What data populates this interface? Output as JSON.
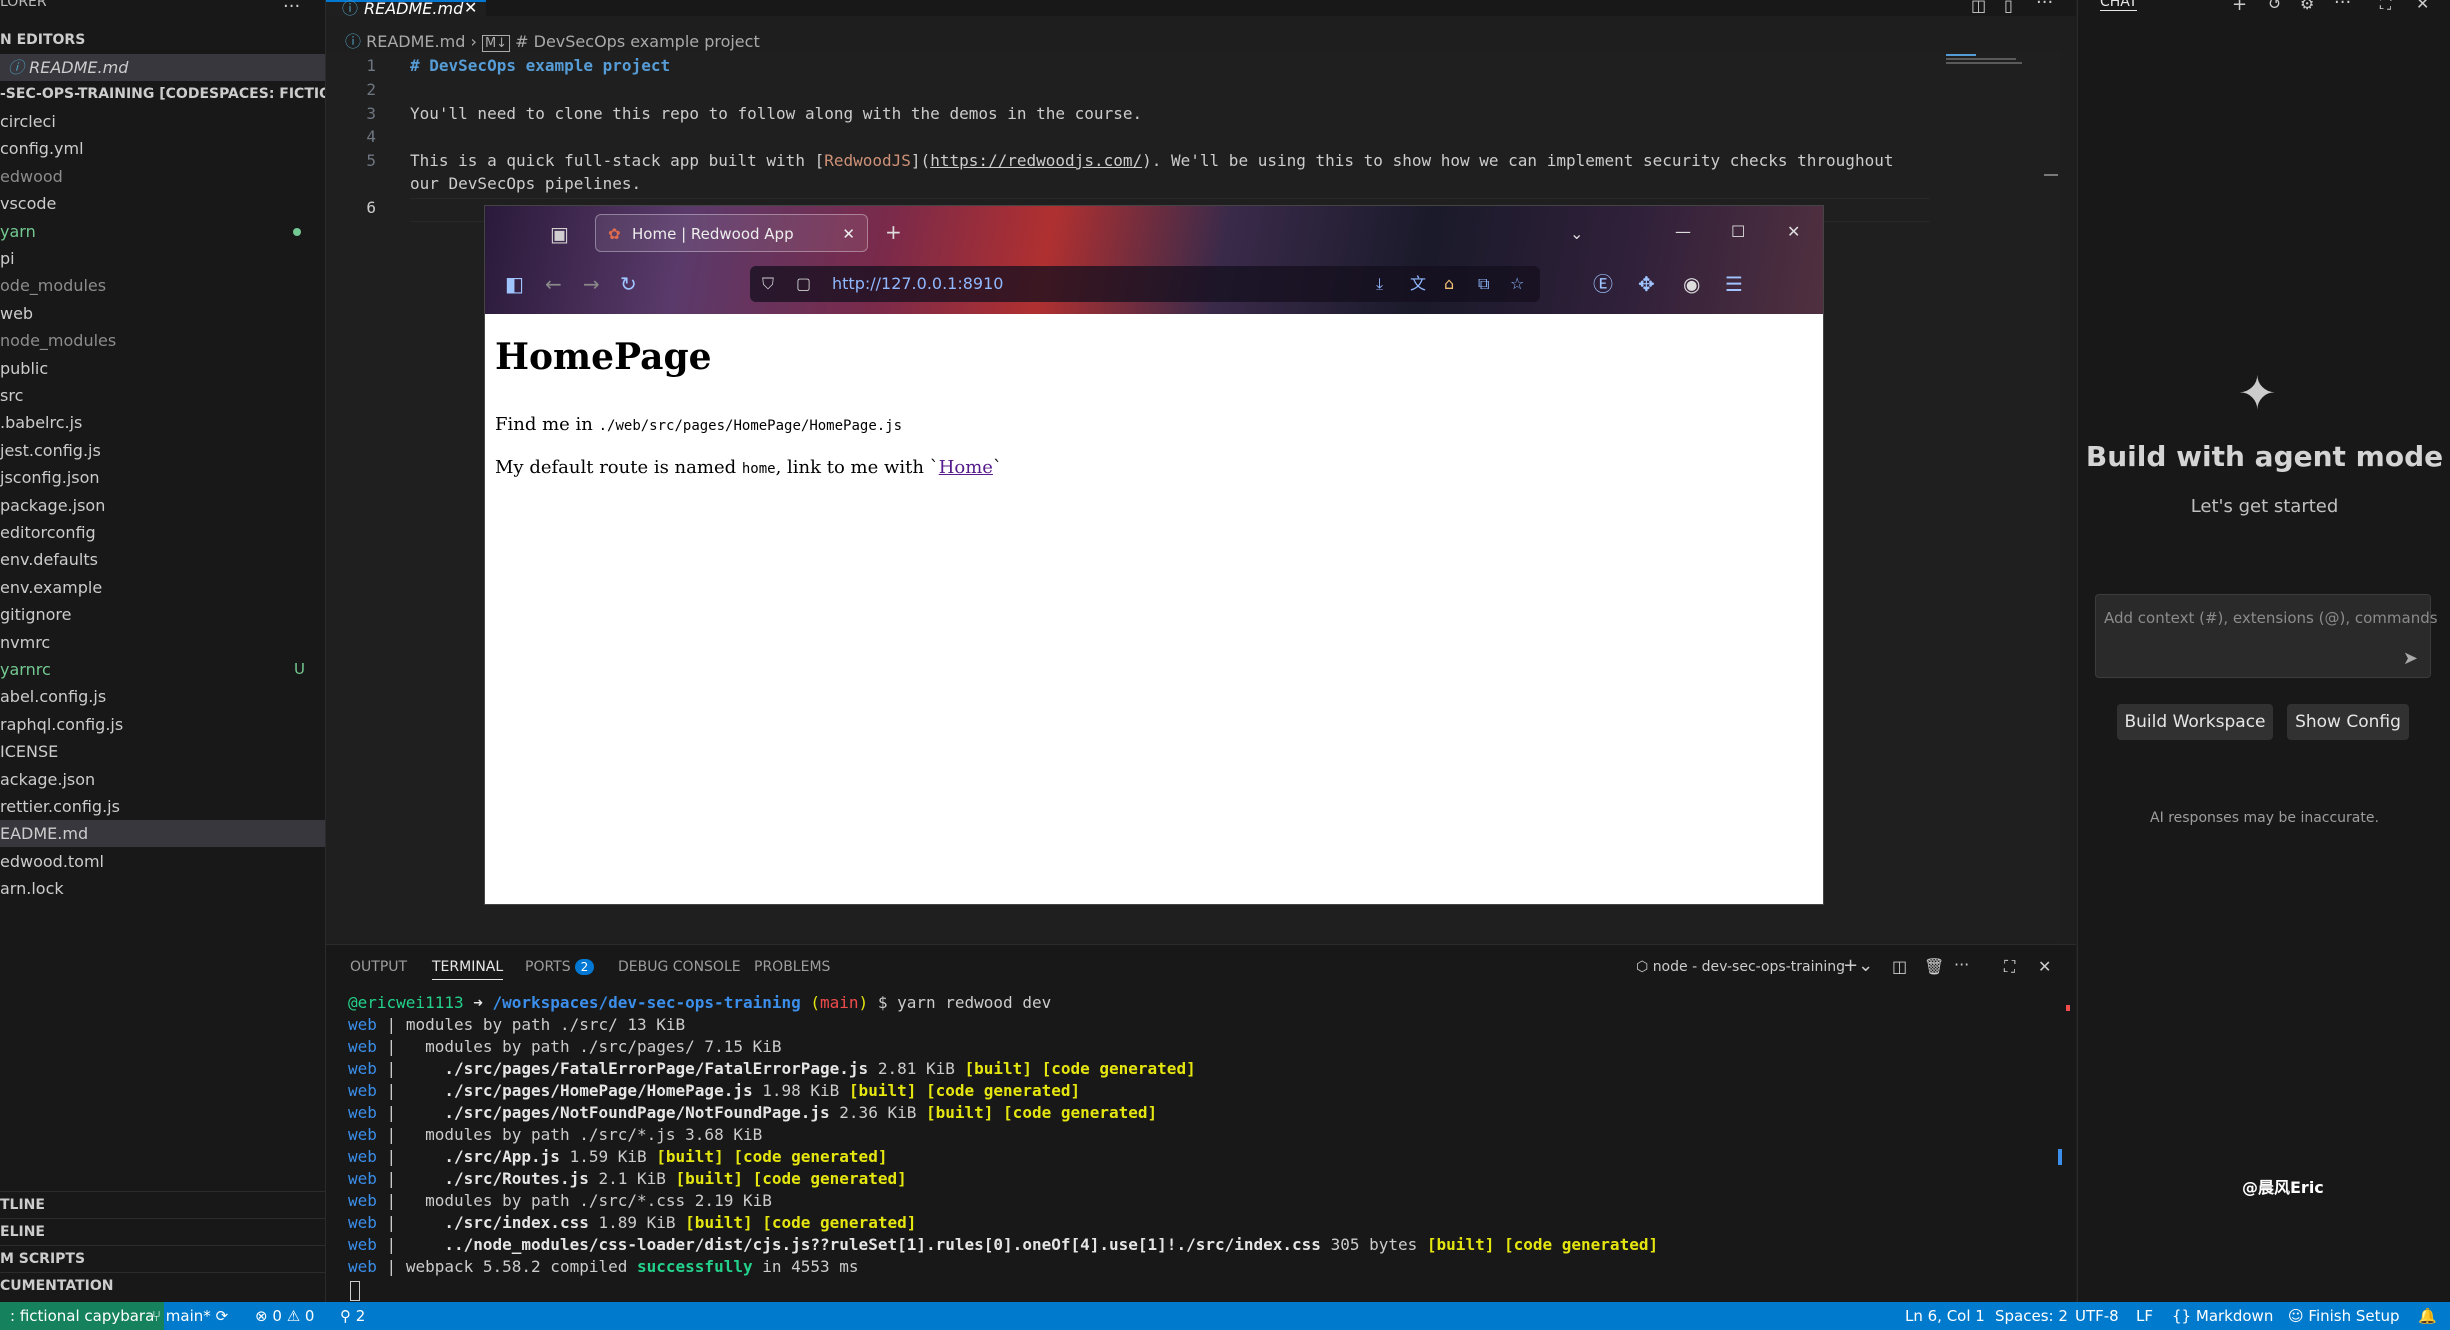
{
  "sidebar": {
    "header": "LORER",
    "open_editors_label": "N EDITORS",
    "open_editor_file": "README.md",
    "repo_label": "-SEC-OPS-TRAINING [CODESPACES: FICTIONAL ...",
    "items": [
      {
        "label": "circleci",
        "color": "#cccccc"
      },
      {
        "label": "config.yml",
        "color": "#cccccc"
      },
      {
        "label": "edwood",
        "color": "#8c8c8c"
      },
      {
        "label": "vscode",
        "color": "#cccccc"
      },
      {
        "label": "yarn",
        "color": "#73c991"
      },
      {
        "label": "pi",
        "color": "#cccccc"
      },
      {
        "label": "ode_modules",
        "color": "#8c8c8c"
      },
      {
        "label": "web",
        "color": "#cccccc"
      },
      {
        "label": "node_modules",
        "color": "#8c8c8c"
      },
      {
        "label": "public",
        "color": "#cccccc"
      },
      {
        "label": "src",
        "color": "#cccccc"
      },
      {
        "label": ".babelrc.js",
        "color": "#cccccc"
      },
      {
        "label": "jest.config.js",
        "color": "#cccccc"
      },
      {
        "label": "jsconfig.json",
        "color": "#cccccc"
      },
      {
        "label": "package.json",
        "color": "#cccccc"
      },
      {
        "label": "editorconfig",
        "color": "#cccccc"
      },
      {
        "label": "env.defaults",
        "color": "#cccccc"
      },
      {
        "label": "env.example",
        "color": "#cccccc"
      },
      {
        "label": "gitignore",
        "color": "#cccccc"
      },
      {
        "label": "nvmrc",
        "color": "#cccccc"
      },
      {
        "label": "yarnrc",
        "color": "#73c991"
      },
      {
        "label": "abel.config.js",
        "color": "#cccccc"
      },
      {
        "label": "raphql.config.js",
        "color": "#cccccc"
      },
      {
        "label": "ICENSE",
        "color": "#cccccc"
      },
      {
        "label": "ackage.json",
        "color": "#cccccc"
      },
      {
        "label": "rettier.config.js",
        "color": "#cccccc"
      },
      {
        "label": "EADME.md",
        "color": "#cccccc"
      },
      {
        "label": "edwood.toml",
        "color": "#cccccc"
      },
      {
        "label": "arn.lock",
        "color": "#cccccc"
      }
    ],
    "untracked_badge": "U",
    "bottom_sections": [
      "TLINE",
      "ELINE",
      "M SCRIPTS",
      "CUMENTATION"
    ]
  },
  "editor": {
    "tab_label": "README.md",
    "breadcrumb_file": "README.md",
    "breadcrumb_symbol": "# DevSecOps example project",
    "line_numbers": [
      "1",
      "2",
      "3",
      "4",
      "5",
      "",
      "6"
    ],
    "line1": "# DevSecOps example project",
    "line3": "You'll need to clone this repo to follow along with the demos in the course.",
    "line5_pre": "This is a quick full-stack app built with [",
    "line5_link": "RedwoodJS",
    "line5_mid": "](",
    "line5_url": "https://redwoodjs.com/",
    "line5_post": "). We'll be using this to show how we can implement security checks throughout",
    "line5_wrap": "our DevSecOps pipelines."
  },
  "browser": {
    "tab_title": "Home | Redwood App",
    "url": "http://127.0.0.1:8910",
    "heading": "HomePage",
    "find_text": "Find me in ",
    "find_path": "./web/src/pages/HomePage/HomePage.js",
    "route_pre": "My default route is named ",
    "route_name": "home",
    "route_mid": ", link to me with `",
    "route_link": "Home",
    "route_post": "`"
  },
  "panel": {
    "tabs": [
      "OUTPUT",
      "TERMINAL",
      "PORTS",
      "DEBUG CONSOLE",
      "PROBLEMS"
    ],
    "ports_count": "2",
    "terminal_name": "node - dev-sec-ops-training",
    "prompt_user": "@ericwei1113",
    "prompt_arrow": " ➜ ",
    "prompt_path": "/workspaces/dev-sec-ops-training",
    "prompt_branch_open": " (",
    "prompt_branch": "main",
    "prompt_branch_close": ")",
    "prompt_cmd": " $ yarn redwood dev",
    "web_prefix": "web",
    "sep": " | ",
    "l1": "modules by path ./src/ 13 KiB",
    "l2": "  modules by path ./src/pages/ 7.15 KiB",
    "l3_path": "    ./src/pages/FatalErrorPage/FatalErrorPage.js",
    "l3_size": " 2.81 KiB ",
    "l4_path": "    ./src/pages/HomePage/HomePage.js",
    "l4_size": " 1.98 KiB ",
    "l5_path": "    ./src/pages/NotFoundPage/NotFoundPage.js",
    "l5_size": " 2.36 KiB ",
    "l6": "  modules by path ./src/*.js 3.68 KiB",
    "l7_path": "    ./src/App.js",
    "l7_size": " 1.59 KiB ",
    "l8_path": "    ./src/Routes.js",
    "l8_size": " 2.1 KiB ",
    "l9": "  modules by path ./src/*.css 2.19 KiB",
    "l10_path": "    ./src/index.css",
    "l10_size": " 1.89 KiB ",
    "l11_path": "    ../node_modules/css-loader/dist/cjs.js??ruleSet[1].rules[0].oneOf[4].use[1]!./src/index.css",
    "l11_size": " 305 bytes ",
    "built": "[built] [code generated]",
    "l12_pre": "webpack 5.58.2 compiled ",
    "l12_ok": "successfully",
    "l12_post": " in 4553 ms"
  },
  "chat": {
    "header": "CHAT",
    "title": "Build with agent mode",
    "subtitle": "Let's get started",
    "input_placeholder": "Add context (#), extensions (@), commands",
    "btn_build": "Build Workspace",
    "btn_config": "Show Config",
    "disclaimer": "AI responses may be inaccurate.",
    "watermark": "@晨风Eric"
  },
  "status": {
    "remote": ": fictional capybara",
    "branch": "main*",
    "errors": "0",
    "warnings": "0",
    "ports": "2",
    "position": "Ln 6, Col 1",
    "spaces": "Spaces: 2",
    "encoding": "UTF-8",
    "eol": "LF",
    "language": "Markdown",
    "finish_setup": "Finish Setup"
  },
  "colors": {
    "accent": "#007acc",
    "remote": "#16825d",
    "git_added": "#73c991"
  }
}
